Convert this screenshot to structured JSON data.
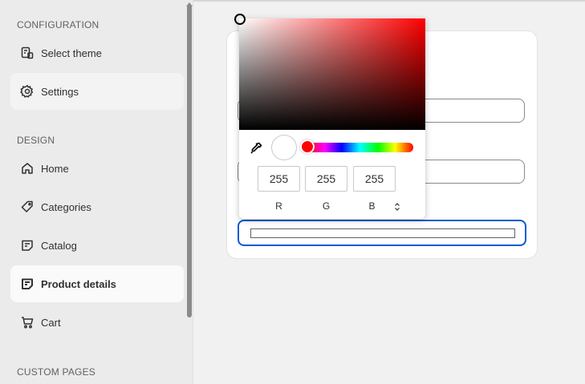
{
  "sidebar": {
    "sections": {
      "configuration": "CONFIGURATION",
      "design": "DESIGN",
      "custom_pages": "CUSTOM PAGES"
    },
    "items": [
      {
        "label": "Select theme",
        "icon": "theme-icon"
      },
      {
        "label": "Settings",
        "icon": "gear-icon"
      },
      {
        "label": "Home",
        "icon": "home-icon"
      },
      {
        "label": "Categories",
        "icon": "tag-icon"
      },
      {
        "label": "Catalog",
        "icon": "note-icon"
      },
      {
        "label": "Product details",
        "icon": "note-icon",
        "active": true
      },
      {
        "label": "Cart",
        "icon": "cart-icon"
      }
    ]
  },
  "color_picker": {
    "r": "255",
    "g": "255",
    "b": "255",
    "labels": {
      "r": "R",
      "g": "G",
      "b": "B"
    },
    "hue_color": "#ff0000",
    "selected_color": "#ffffff",
    "focus_color": "#005bd3"
  }
}
